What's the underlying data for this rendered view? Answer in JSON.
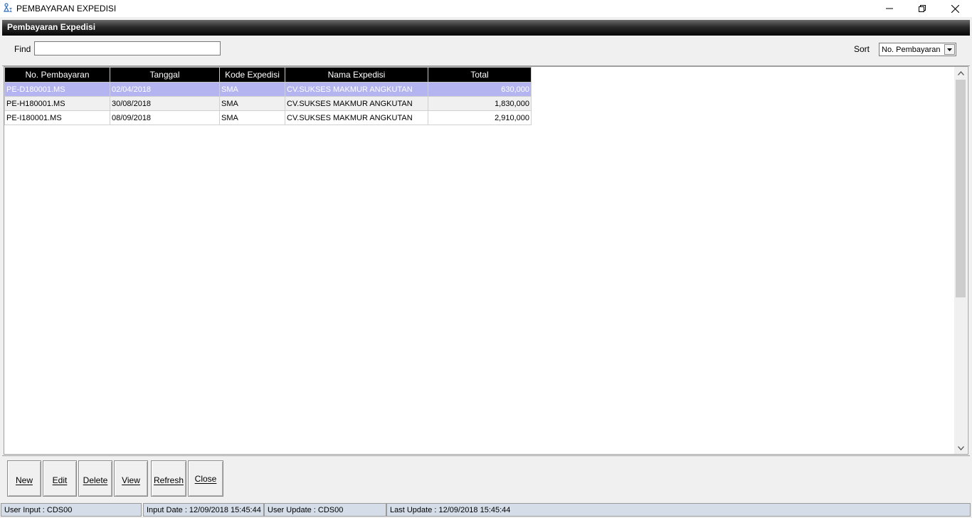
{
  "window": {
    "title": "PEMBAYARAN EXPEDISI",
    "icon": "person-hourglass-icon"
  },
  "panel": {
    "title": "Pembayaran Expedisi"
  },
  "search": {
    "find_label": "Find",
    "find_value": "",
    "sort_label": "Sort",
    "sort_value": "No. Pembayaran"
  },
  "grid": {
    "columns": [
      "No. Pembayaran",
      "Tanggal",
      "Kode Expedisi",
      "Nama Expedisi",
      "Total"
    ],
    "rows": [
      {
        "no": "PE-D180001.MS",
        "tanggal": "02/04/2018",
        "kode": "SMA",
        "nama": "CV.SUKSES MAKMUR ANGKUTAN",
        "total": "630,000",
        "selected": true
      },
      {
        "no": "PE-H180001.MS",
        "tanggal": "30/08/2018",
        "kode": "SMA",
        "nama": "CV.SUKSES MAKMUR ANGKUTAN",
        "total": "1,830,000"
      },
      {
        "no": "PE-I180001.MS",
        "tanggal": "08/09/2018",
        "kode": "SMA",
        "nama": "CV.SUKSES MAKMUR ANGKUTAN",
        "total": "2,910,000"
      }
    ]
  },
  "buttons": {
    "new": "New",
    "edit": "Edit",
    "delete": "Delete",
    "view": "View",
    "refresh": "Refresh",
    "close": "Close"
  },
  "status": {
    "user_input": "User Input :  CDS00",
    "input_date": "Input Date :  12/09/2018 15:45:44",
    "user_update": "User Update :  CDS00",
    "last_update": "Last Update :    12/09/2018 15:45:44"
  },
  "colors": {
    "header_bg": "#000000",
    "selected_row": "#b4b4f0",
    "status_bg": "#d4dde8"
  }
}
